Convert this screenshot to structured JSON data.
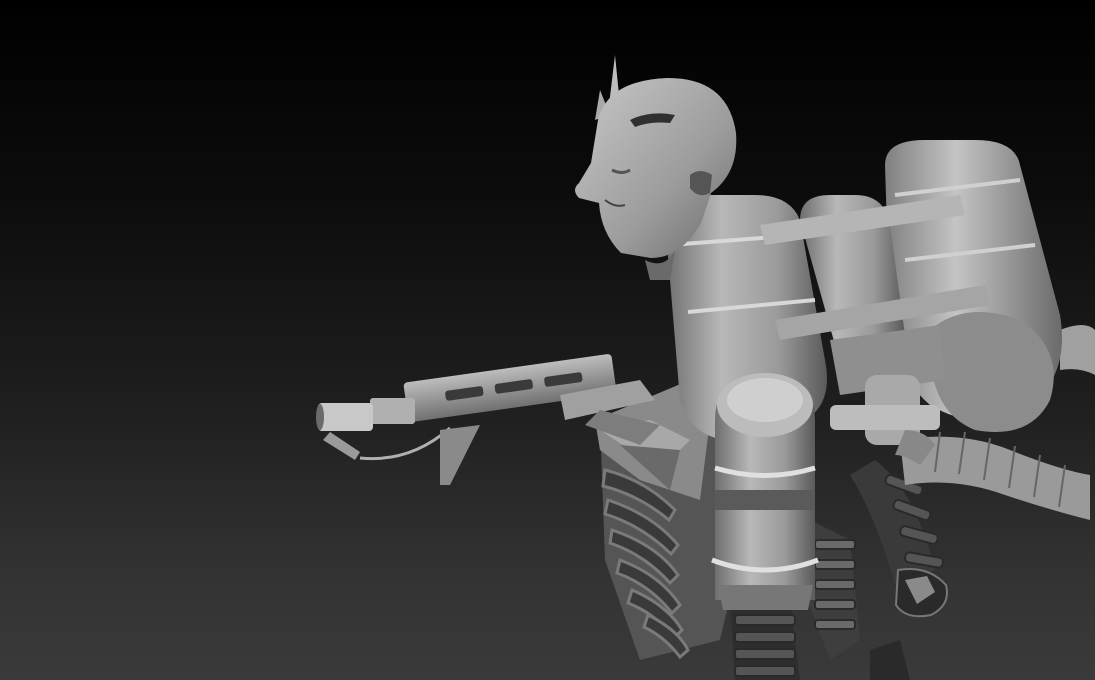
{
  "viewport": {
    "background_top": "#000000",
    "background_bottom": "#3a3a3a",
    "material_color": "#9a9a9a"
  },
  "model": {
    "parts": [
      "head",
      "backpack-tanks",
      "flamethrower-gun",
      "hose",
      "ribcage",
      "arm"
    ]
  }
}
